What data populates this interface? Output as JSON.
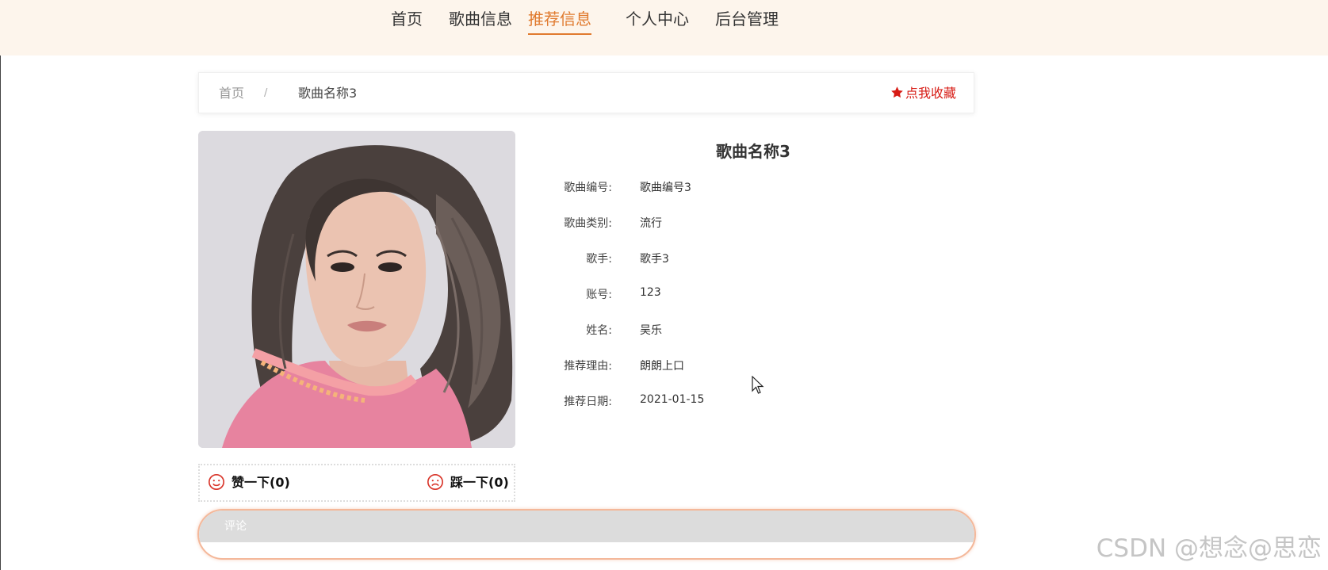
{
  "nav": {
    "items": [
      {
        "label": "首页"
      },
      {
        "label": "歌曲信息"
      },
      {
        "label": "推荐信息"
      },
      {
        "label": "个人中心"
      },
      {
        "label": "后台管理"
      }
    ],
    "active_index": 2
  },
  "breadcrumb": {
    "home": "首页",
    "separator": "/",
    "current": "歌曲名称3"
  },
  "favorite": {
    "label": "点我收藏",
    "icon": "star-icon"
  },
  "cover": {
    "icon": "singer-photo"
  },
  "votes": {
    "like_label": "赞一下(0)",
    "dislike_label": "踩一下(0)",
    "like_icon": "smile-face-icon",
    "dislike_icon": "sad-face-icon"
  },
  "detail": {
    "title": "歌曲名称3",
    "fields": [
      {
        "label": "歌曲编号:",
        "value": "歌曲编号3"
      },
      {
        "label": "歌曲类别:",
        "value": "流行"
      },
      {
        "label": "歌手:",
        "value": "歌手3"
      },
      {
        "label": "账号:",
        "value": "123"
      },
      {
        "label": "姓名:",
        "value": "吴乐"
      },
      {
        "label": "推荐理由:",
        "value": "朗朗上口"
      },
      {
        "label": "推荐日期:",
        "value": "2021-01-15"
      }
    ]
  },
  "comment": {
    "label": "评论"
  },
  "watermark": "CSDN @想念@思恋",
  "colors": {
    "accent": "#e07a2e",
    "favorite": "#d71b14",
    "nav_bg": "#fdf5ec",
    "comment_border": "#f4b89a"
  }
}
